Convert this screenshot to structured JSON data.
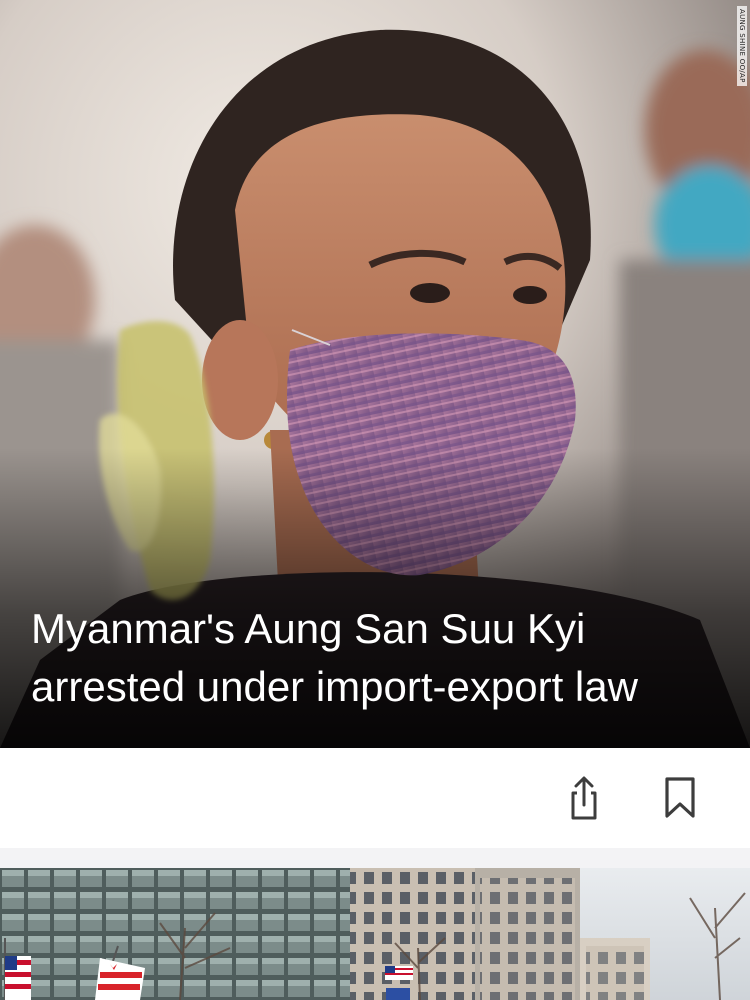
{
  "hero": {
    "headline": "Myanmar's Aung San Suu Kyi arrested under import-export law",
    "photo_credit": "AUNG SHINE OO/AP",
    "image_icon": "news-photo"
  },
  "actions": {
    "share_icon": "share-icon",
    "bookmark_icon": "bookmark-icon"
  },
  "next_story": {
    "image_icon": "city-street-photo"
  },
  "colors": {
    "headline_text": "#ffffff",
    "action_icon": "#3d3d3d",
    "divider": "#f3f3f5"
  }
}
